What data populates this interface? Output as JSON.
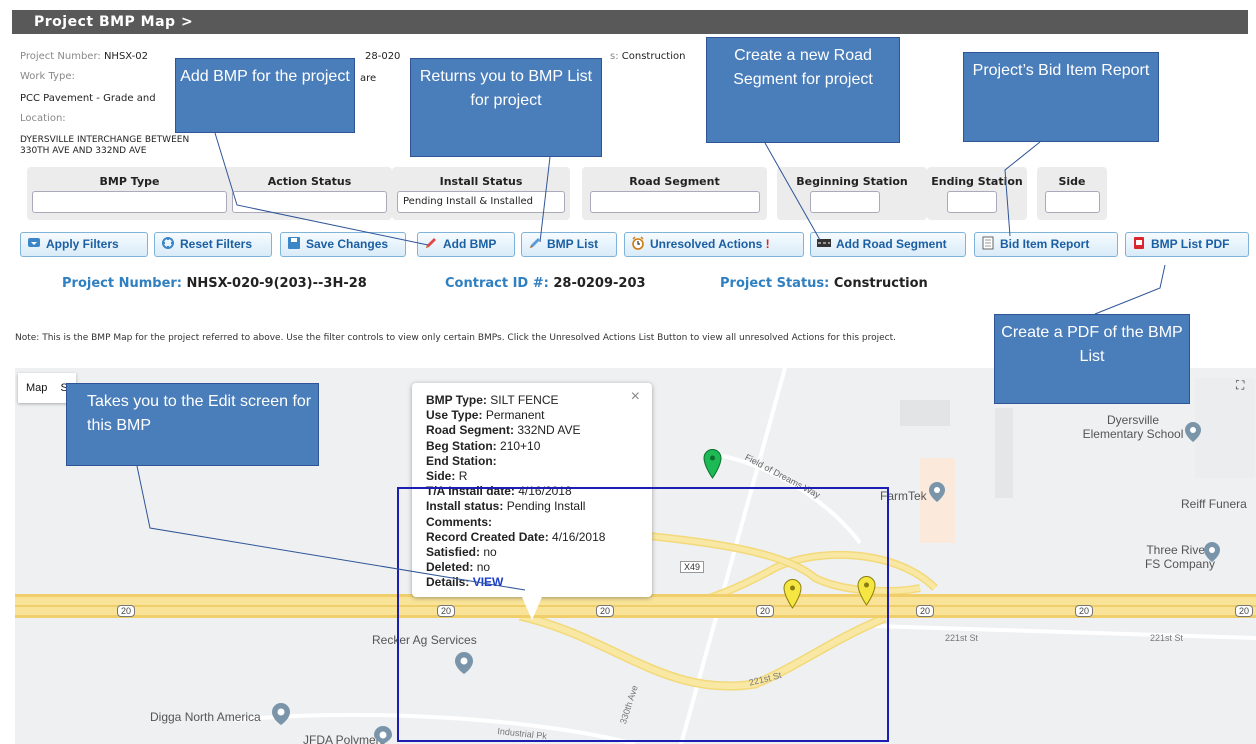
{
  "title": "Project BMP Map >",
  "project_meta": {
    "project_number_label": "Project Number:",
    "project_number_value": "NHSX-02",
    "contract_partial": "28-020",
    "status_partial_label": "s:",
    "status_partial_value": "Construction",
    "work_type_label": "Work Type:",
    "work_type_partial": "are",
    "work_type_value": "PCC Pavement - Grade and",
    "location_label": "Location:",
    "location_line1": "DYERSVILLE INTERCHANGE BETWEEN",
    "location_line2": "330TH AVE AND 332ND AVE"
  },
  "filters": {
    "bmp_type_label": "BMP Type",
    "action_status_label": "Action Status",
    "install_status_label": "Install Status",
    "install_status_value": "Pending Install & Installed",
    "road_segment_label": "Road Segment",
    "beginning_station_label": "Beginning Station",
    "ending_station_label": "Ending Station",
    "side_label": "Side"
  },
  "buttons": {
    "apply_filters": "Apply Filters",
    "reset_filters": "Reset Filters",
    "save_changes": "Save Changes",
    "add_bmp": "Add BMP",
    "bmp_list": "BMP List",
    "unresolved_actions": "Unresolved Actions",
    "unresolved_mark": "!",
    "add_road_segment": "Add Road Segment",
    "bid_item_report": "Bid Item Report",
    "bmp_list_pdf": "BMP List PDF"
  },
  "summary": {
    "project_number_label": "Project Number:",
    "project_number_value": "NHSX-020-9(203)--3H-28",
    "contract_label": "Contract ID #:",
    "contract_value": "28-0209-203",
    "status_label": "Project Status:",
    "status_value": "Construction"
  },
  "note": "Note: This is the BMP Map for the project referred to above. Use the filter controls to view only certain BMPs. Click the Unresolved Actions List Button to view all unresolved Actions for this project.",
  "map": {
    "mode_label": "Map",
    "mode_label2": "S",
    "labels": {
      "dyersville_school": "Dyersville\nElementary School",
      "farmtek": "FarmTek",
      "reiff": "Reiff Funera",
      "three_rivers": "Three Rivers\nFS Company",
      "recker": "Recker Ag Services",
      "digga": "Digga North America",
      "jfda": "JFDA Polymers",
      "field_of_dreams": "Field of Dreams Way",
      "st_221_a": "221st St",
      "st_221_b": "221st St",
      "st_221_c": "221st St",
      "ave_330": "330th Ave",
      "industrial": "Industrial Pk",
      "x49": "X49",
      "route_20": "20"
    }
  },
  "popup": {
    "bmp_type_label": "BMP Type:",
    "bmp_type": "SILT FENCE",
    "use_type_label": "Use Type:",
    "use_type": "Permanent",
    "road_segment_label": "Road Segment:",
    "road_segment": "332ND AVE",
    "beg_station_label": "Beg Station:",
    "beg_station": "210+10",
    "end_station_label": "End Station:",
    "end_station": "",
    "side_label": "Side:",
    "side": "R",
    "ta_install_label": "T/A Install date:",
    "ta_install": "4/16/2018",
    "install_status_label": "Install status:",
    "install_status": "Pending Install",
    "comments_label": "Comments:",
    "comments": "",
    "record_created_label": "Record Created Date:",
    "record_created": "4/16/2018",
    "satisfied_label": "Satisfied:",
    "satisfied": "no",
    "deleted_label": "Deleted:",
    "deleted": "no",
    "details_label": "Details:",
    "details_link": "VIEW",
    "close": "×"
  },
  "callouts": {
    "add_bmp": "Add BMP for the project",
    "bmp_list": "Returns you to BMP List for project",
    "road_segment": "Create a new Road Segment for project",
    "bid_item": "Project’s Bid Item Report",
    "pdf": "Create a PDF of the BMP List",
    "edit": "Takes you to the Edit screen for this BMP"
  },
  "colors": {
    "title_bg": "#595959",
    "button_text": "#1b5fa3",
    "summary_key": "#2f7fc1",
    "callout_bg": "#4a7ebb",
    "highway": "#f7e08c",
    "marker_green": "#1db954",
    "marker_yellow": "#f5e642",
    "selection_border": "#1d1db3"
  }
}
